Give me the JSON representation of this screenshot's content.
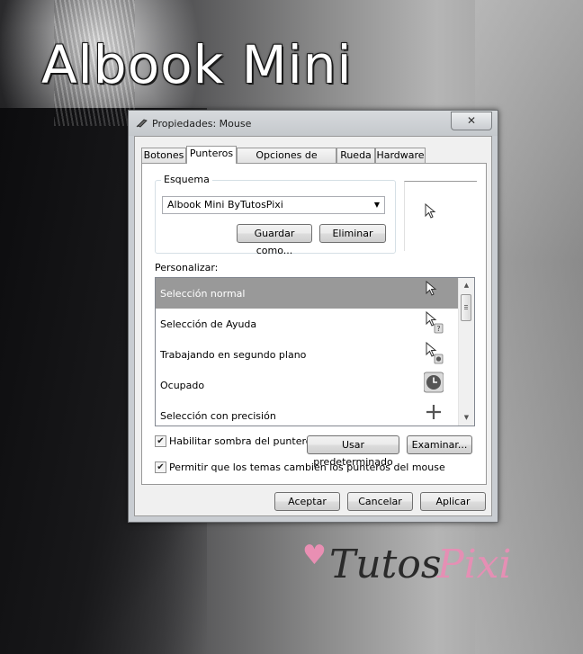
{
  "background_art": {
    "title": "Albook Mini",
    "watermark_part1": "Tutos",
    "watermark_part2": "Pixi"
  },
  "window": {
    "title": "Propiedades: Mouse",
    "close_label": "✕"
  },
  "tabs": [
    {
      "label": "Botones",
      "active": false
    },
    {
      "label": "Punteros",
      "active": true
    },
    {
      "label": "Opciones de puntero",
      "active": false
    },
    {
      "label": "Rueda",
      "active": false
    },
    {
      "label": "Hardware",
      "active": false
    }
  ],
  "scheme": {
    "group_label": "Esquema",
    "selected": "Albook Mini ByTutosPixi",
    "save_as_label": "Guardar como...",
    "delete_label": "Eliminar"
  },
  "customize": {
    "label": "Personalizar:",
    "items": [
      {
        "label": "Selección normal",
        "icon": "arrow-cursor-icon",
        "selected": true
      },
      {
        "label": "Selección de Ayuda",
        "icon": "help-cursor-icon",
        "selected": false
      },
      {
        "label": "Trabajando en segundo plano",
        "icon": "working-cursor-icon",
        "selected": false
      },
      {
        "label": "Ocupado",
        "icon": "busy-clock-icon",
        "selected": false
      },
      {
        "label": "Selección con precisión",
        "icon": "crosshair-icon",
        "selected": false
      }
    ]
  },
  "options": {
    "shadow_label": "Habilitar sombra del puntero",
    "shadow_checked": true,
    "use_default_label": "Usar predeterminado",
    "browse_label": "Examinar...",
    "themes_label": "Permitir que los temas cambien los punteros del mouse",
    "themes_checked": true
  },
  "footer": {
    "ok_label": "Aceptar",
    "cancel_label": "Cancelar",
    "apply_label": "Aplicar"
  },
  "colors": {
    "selected_row": "#999999",
    "window_frame": "#c9cdd2"
  }
}
